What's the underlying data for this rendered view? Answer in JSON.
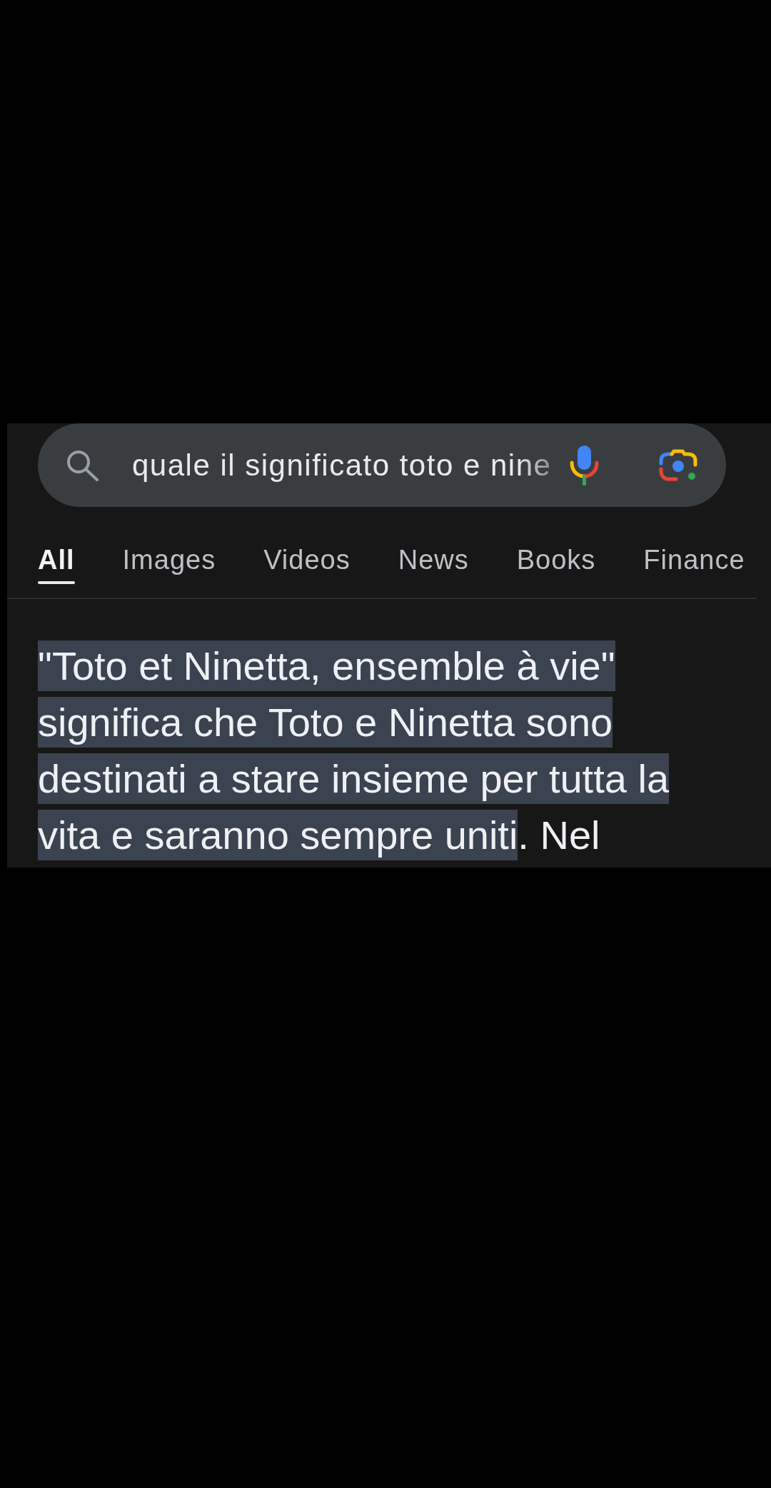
{
  "search": {
    "value": "quale il significato toto e nine"
  },
  "tabs": [
    {
      "label": "All",
      "selected": true
    },
    {
      "label": "Images",
      "selected": false
    },
    {
      "label": "Videos",
      "selected": false
    },
    {
      "label": "News",
      "selected": false
    },
    {
      "label": "Books",
      "selected": false
    },
    {
      "label": "Finance",
      "selected": false
    }
  ],
  "answer": {
    "segments": [
      {
        "text": "\"Toto et Ninetta, ensemble à vie\" significa che Toto e Ninetta sono destinati a stare insieme per tutta la vita e saranno sempre uniti",
        "highlighted": true
      },
      {
        "text": ". Nel",
        "highlighted": false
      }
    ]
  }
}
